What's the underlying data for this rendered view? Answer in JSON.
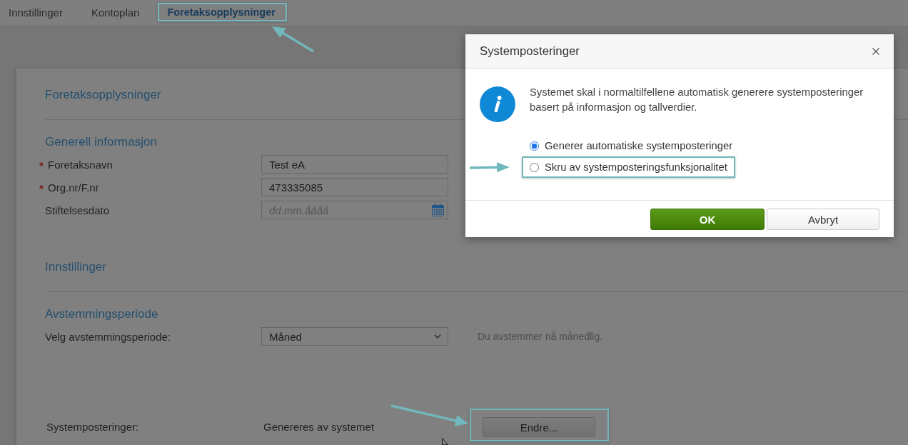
{
  "tabs": [
    {
      "label": "Innstillinger",
      "selected": false,
      "highlighted": false
    },
    {
      "label": "Kontoplan",
      "selected": false,
      "highlighted": false
    },
    {
      "label": "Foretaksopplysninger",
      "selected": true,
      "highlighted": true
    }
  ],
  "form": {
    "groups": [
      {
        "title": "Foretaksopplysninger",
        "sections": [
          {
            "heading": "Generell informasjon",
            "fields": [
              {
                "kind": "text",
                "label": "Foretaksnavn",
                "required": true,
                "value": "Test eA"
              },
              {
                "kind": "text",
                "label": "Org.nr/F.nr",
                "required": true,
                "value": "473335085"
              },
              {
                "kind": "date",
                "label": "Stiftelsesdato",
                "required": false,
                "placeholder": "dd.mm.åååå"
              }
            ]
          }
        ]
      },
      {
        "title": "Innstillinger",
        "sections": [
          {
            "heading": "Avstemmingsperiode",
            "fields": [
              {
                "kind": "select",
                "label": "Velg avstemmingsperiode:",
                "required": false,
                "value": "Måned",
                "hint": "Du avstemmer nå månedlig."
              }
            ]
          }
        ]
      }
    ],
    "system_postings": {
      "label": "Systemposteringer:",
      "value": "Genereres av systemet",
      "button": {
        "label": "Endre...",
        "highlighted": true
      }
    }
  },
  "dialog": {
    "title": "Systemposteringer",
    "message": "Systemet skal i normaltilfellene automatisk generere systemposteringer basert på informasjon og tallverdier.",
    "options": [
      {
        "label": "Generer automatiske systemposteringer",
        "selected": true,
        "highlighted": false
      },
      {
        "label": "Skru av systemposteringsfunksjonalitet",
        "selected": false,
        "highlighted": true
      }
    ],
    "buttons": [
      {
        "label": "OK",
        "kind": "primary"
      },
      {
        "label": "Avbryt",
        "kind": "secondary"
      }
    ]
  }
}
